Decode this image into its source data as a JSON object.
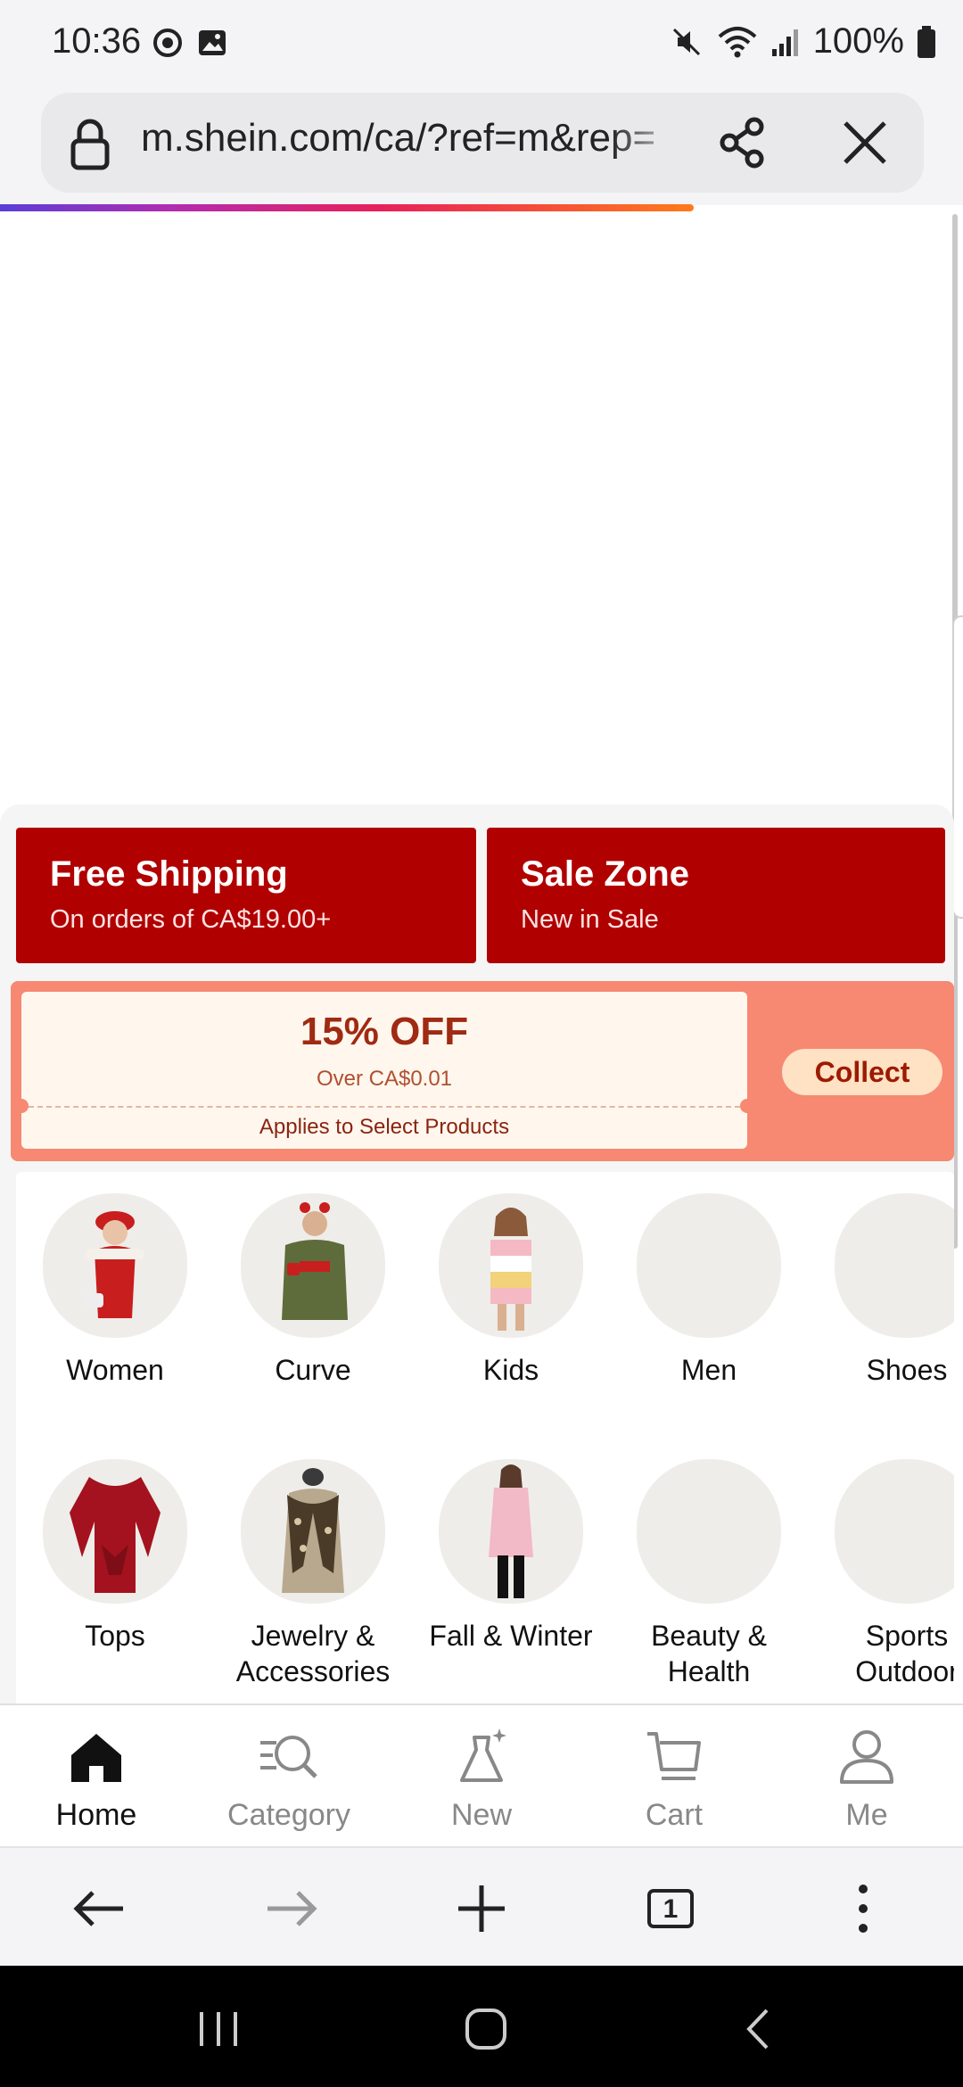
{
  "status_bar": {
    "time": "10:36",
    "battery": "100%",
    "icons": [
      "sync-icon",
      "gallery-icon",
      "mute-icon",
      "wifi-icon",
      "signal-icon",
      "battery-icon"
    ]
  },
  "browser": {
    "url": "m.shein.com/ca/?ref=m&rep=",
    "load_progress_percent": 80,
    "tab_count": "1"
  },
  "promos": [
    {
      "title": "Free Shipping",
      "subtitle": "On orders of CA$19.00+"
    },
    {
      "title": "Sale Zone",
      "subtitle": "New in Sale"
    }
  ],
  "coupon": {
    "value": "15% OFF",
    "minimum": "Over CA$0.01",
    "scope": "Applies to Select Products",
    "action": "Collect"
  },
  "categories": [
    {
      "label": "Women"
    },
    {
      "label": "Curve"
    },
    {
      "label": "Kids"
    },
    {
      "label": "Men"
    },
    {
      "label": "Shoes"
    },
    {
      "label": "Tops"
    },
    {
      "label": "Jewelry &\nAccessories"
    },
    {
      "label": "Fall & Winter"
    },
    {
      "label": "Beauty &\nHealth"
    },
    {
      "label": "Sports\nOutdoor"
    }
  ],
  "bottom_nav": [
    {
      "label": "Home",
      "icon": "home-icon",
      "active": true
    },
    {
      "label": "Category",
      "icon": "category-search-icon"
    },
    {
      "label": "New",
      "icon": "new-dress-icon"
    },
    {
      "label": "Cart",
      "icon": "cart-icon"
    },
    {
      "label": "Me",
      "icon": "profile-icon"
    }
  ],
  "colors": {
    "promo_red": "#b10000",
    "coupon_bg": "#f78872",
    "coupon_ticket": "#fff7ee",
    "collect_button": "#ffe1c4"
  }
}
